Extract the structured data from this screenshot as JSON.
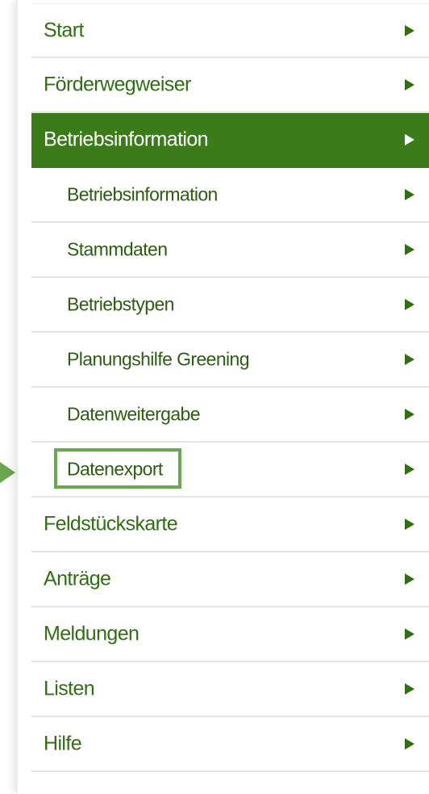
{
  "colors": {
    "accent_green": "#3b7b1a",
    "text_green": "#2f6f12",
    "highlight_green": "#6aa84f",
    "divider": "#e4e4e4"
  },
  "nav": {
    "items": [
      {
        "label": "Start",
        "level": 1,
        "active": false,
        "icon": "chevron-right-icon"
      },
      {
        "label": "Förderwegweiser",
        "level": 1,
        "active": false,
        "icon": "chevron-right-icon"
      },
      {
        "label": "Betriebsinformation",
        "level": 1,
        "active": true,
        "icon": "chevron-right-icon"
      },
      {
        "label": "Betriebsinformation",
        "level": 2,
        "active": false,
        "icon": "chevron-right-icon"
      },
      {
        "label": "Stammdaten",
        "level": 2,
        "active": false,
        "icon": "chevron-right-icon"
      },
      {
        "label": "Betriebstypen",
        "level": 2,
        "active": false,
        "icon": "chevron-right-icon"
      },
      {
        "label": "Planungshilfe Greening",
        "level": 2,
        "active": false,
        "icon": "chevron-right-icon"
      },
      {
        "label": "Datenweitergabe",
        "level": 2,
        "active": false,
        "icon": "chevron-right-icon"
      },
      {
        "label": "Datenexport",
        "level": 2,
        "active": false,
        "highlighted": true,
        "icon": "chevron-right-icon"
      },
      {
        "label": "Feldstückskarte",
        "level": 1,
        "active": false,
        "icon": "chevron-right-icon"
      },
      {
        "label": "Anträge",
        "level": 1,
        "active": false,
        "icon": "chevron-right-icon"
      },
      {
        "label": "Meldungen",
        "level": 1,
        "active": false,
        "icon": "chevron-right-icon"
      },
      {
        "label": "Listen",
        "level": 1,
        "active": false,
        "icon": "chevron-right-icon"
      },
      {
        "label": "Hilfe",
        "level": 1,
        "active": false,
        "icon": "chevron-right-icon"
      }
    ]
  }
}
